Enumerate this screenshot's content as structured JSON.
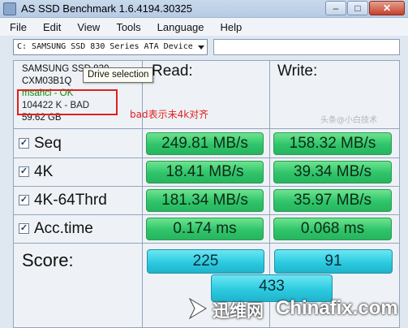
{
  "window": {
    "title": "AS SSD Benchmark 1.6.4194.30325"
  },
  "menu": [
    "File",
    "Edit",
    "View",
    "Tools",
    "Language",
    "Help"
  ],
  "drive": {
    "selected": "C: SAMSUNG SSD 830 Series ATA Device"
  },
  "tooltip": "Drive selection",
  "info": {
    "model": "SAMSUNG SSD 830",
    "firmware": "CXM03B1Q",
    "driver": "msahci - OK",
    "alignment": "104422 K - BAD",
    "size": "59.62 GB"
  },
  "annotation": "bad表示未4k对齐",
  "headers": {
    "read": "Read:",
    "write": "Write:"
  },
  "rows": [
    {
      "label": "Seq",
      "checked": true,
      "read": "249.81 MB/s",
      "write": "158.32 MB/s"
    },
    {
      "label": "4K",
      "checked": true,
      "read": "18.41 MB/s",
      "write": "39.34 MB/s"
    },
    {
      "label": "4K-64Thrd",
      "checked": true,
      "read": "181.34 MB/s",
      "write": "35.97 MB/s"
    },
    {
      "label": "Acc.time",
      "checked": true,
      "read": "0.174 ms",
      "write": "0.068 ms"
    }
  ],
  "score": {
    "label": "Score:",
    "read": "225",
    "write": "91",
    "total": "433"
  },
  "watermark": {
    "cn": "迅维网",
    "en": "Chinafix.com",
    "faint": "头条@小白技术"
  },
  "colors": {
    "value_box": "#2fc46a",
    "score_box": "#2ccbe0",
    "annotation": "#e32020",
    "highlight": "#e02020",
    "ok": "#0a8a10"
  }
}
